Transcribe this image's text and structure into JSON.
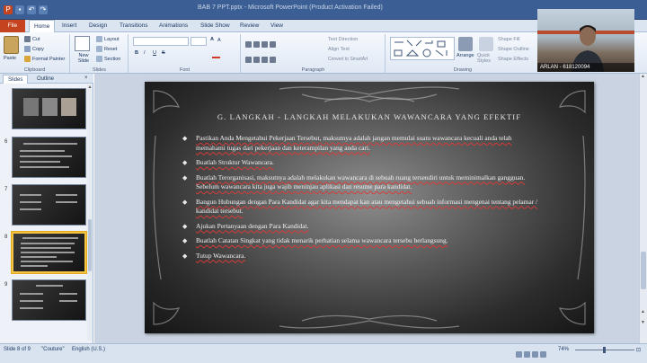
{
  "window": {
    "title": "BAB 7 PPT.pptx - Microsoft PowerPoint (Product Activation Failed)"
  },
  "ribbon": {
    "file_tab": "File",
    "tabs": [
      "Home",
      "Insert",
      "Design",
      "Transitions",
      "Animations",
      "Slide Show",
      "Review",
      "View"
    ],
    "clipboard": {
      "paste": "Paste",
      "cut": "Cut",
      "copy": "Copy",
      "format_painter": "Format Painter",
      "label": "Clipboard"
    },
    "slides": {
      "new_slide": "New Slide",
      "layout": "Layout",
      "reset": "Reset",
      "section": "Section",
      "label": "Slides"
    },
    "font": {
      "label": "Font",
      "bold": "B",
      "italic": "I",
      "underline": "U",
      "strike": "S"
    },
    "paragraph": {
      "text_direction": "Text Direction",
      "align_text": "Align Text",
      "convert_smartart": "Convert to SmartArt",
      "label": "Paragraph"
    },
    "drawing": {
      "arrange": "Arrange",
      "quick_styles": "Quick Styles",
      "shape_fill": "Shape Fill",
      "shape_outline": "Shape Outline",
      "shape_effects": "Shape Effects",
      "label": "Drawing"
    }
  },
  "slides_panel": {
    "tabs": [
      "Slides",
      "Outline"
    ],
    "thumbnails": [
      {
        "num": ""
      },
      {
        "num": "6"
      },
      {
        "num": "7"
      },
      {
        "num": "8"
      },
      {
        "num": "9"
      }
    ],
    "selected_index": 3
  },
  "slide": {
    "title": "G. LANGKAH - LANGKAH MELAKUKAN WAWANCARA YANG EFEKTIF",
    "bullets": [
      "Pastikan Anda Mengetahui Pekerjaan Tersebut, maksutnya adalah jangan memulai suatu wawancara kecuali anda telah memahami tugas dari pekerjaan dan keterampilan yang anda cari.",
      "Buatlah Struktur Wawancara.",
      "Buatlah Terorganisasi, maksutnya adalah melakukan wawancara di sebuah ruang tersendiri untuk meminimalkan gangguan. Sebelum wawancara kita juga wajib meninjau aplikasi dan resume para kandidat.",
      " Bangun Hubungan dengan Para Kandidat agar kita mendapat kan atau mengetahui sebuah informasi mengenai tentang pelamar / kandidat tersebut.",
      " Ajukan Pertanyaan dengan Para Kandidat.",
      "Buatlah Catatan Singkat yang tidak menarik perhatian selama wawancara tersebu berlangsung.",
      "Tutup Wawancara."
    ]
  },
  "statusbar": {
    "slide_info": "Slide 8 of 9",
    "theme": "\"Couture\"",
    "language": "English (U.S.)",
    "zoom": "74%"
  },
  "webcam": {
    "label": "ARLAN - 618120094"
  },
  "colors": {
    "titlebar": "#3b5f94",
    "file_tab": "#c5431f",
    "selected_thumb": "#f4c542",
    "spell_underline": "#d93a3a"
  }
}
